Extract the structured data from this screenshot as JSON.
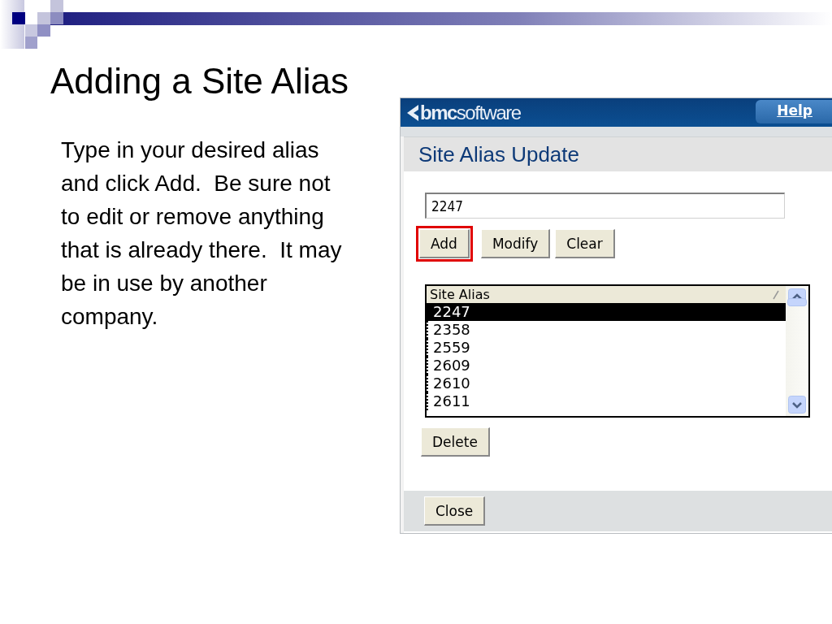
{
  "slide": {
    "title": "Adding a Site Alias",
    "body": "Type in your desired alias and click Add.  Be sure not to edit or remove anything that is already there.  It may be in use by another company."
  },
  "app": {
    "logo": "**bmc**software",
    "help_link": "Help",
    "page_title": "Site Alias Update",
    "alias_field": {
      "value": "2247"
    },
    "buttons": [
      {
        "label": "Add",
        "highlighted": true
      },
      {
        "label": "Modify",
        "highlighted": false
      },
      {
        "label": "Clear",
        "highlighted": false
      }
    ],
    "list": {
      "column": "Site Alias",
      "rows": [
        {
          "value": "2247",
          "selected": true
        },
        {
          "value": "2358",
          "selected": false
        },
        {
          "value": "2559",
          "selected": false
        },
        {
          "value": "2609",
          "selected": false
        },
        {
          "value": "2610",
          "selected": false
        },
        {
          "value": "2611",
          "selected": false
        }
      ]
    },
    "delete_button": "Delete",
    "close_button": "Close"
  }
}
